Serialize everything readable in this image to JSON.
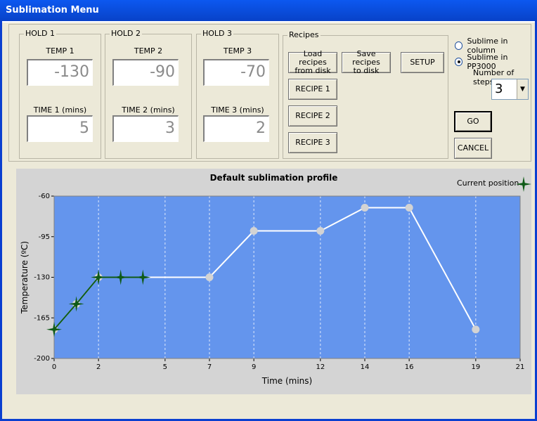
{
  "window": {
    "title": "Sublimation Menu"
  },
  "holds": [
    {
      "legend": "HOLD 1",
      "temp_label": "TEMP 1",
      "temp_value": "-130",
      "time_label": "TIME 1 (mins)",
      "time_value": "5"
    },
    {
      "legend": "HOLD 2",
      "temp_label": "TEMP 2",
      "temp_value": "-90",
      "time_label": "TIME 2 (mins)",
      "time_value": "3"
    },
    {
      "legend": "HOLD 3",
      "temp_label": "TEMP 3",
      "temp_value": "-70",
      "time_label": "TIME 3 (mins)",
      "time_value": "2"
    }
  ],
  "recipes": {
    "legend": "Recipes",
    "load_label": "Load recipes\nfrom disk",
    "save_label": "Save recipes\nto disk",
    "setup_label": "SETUP",
    "recipe1": "RECIPE 1",
    "recipe2": "RECIPE 2",
    "recipe3": "RECIPE 3"
  },
  "options": {
    "radio_column": "Sublime in column",
    "radio_pp3000": "Sublime in PP3000",
    "selected_radio": "pp3000",
    "steps_label": "Number of steps",
    "steps_value": "3",
    "go_label": "GO",
    "cancel_label": "CANCEL"
  },
  "chart_data": {
    "type": "line",
    "title": "Default sublimation profile",
    "xlabel": "Time (mins)",
    "ylabel": "Temperature (ºC)",
    "legend_current": "Current position",
    "xlim": [
      0,
      21
    ],
    "ylim": [
      -200,
      -60
    ],
    "x_ticks": [
      0,
      2,
      5,
      7,
      9,
      12,
      14,
      16,
      19,
      21
    ],
    "x_tick_labels": [
      "0",
      "2",
      "5",
      "7",
      "9",
      "12",
      "14",
      "16",
      "19",
      "21"
    ],
    "y_ticks": [
      -60,
      -95,
      -130,
      -165,
      -200
    ],
    "y_tick_labels": [
      "-60",
      "-95",
      "-130",
      "-165",
      "-200"
    ],
    "profile": [
      {
        "x": 0,
        "y": -175
      },
      {
        "x": 1.0,
        "y": -153
      },
      {
        "x": 2.0,
        "y": -130
      },
      {
        "x": 7.0,
        "y": -130
      },
      {
        "x": 9.0,
        "y": -90
      },
      {
        "x": 12.0,
        "y": -90
      },
      {
        "x": 14.0,
        "y": -70
      },
      {
        "x": 16.0,
        "y": -70
      },
      {
        "x": 19.0,
        "y": -175
      }
    ],
    "current_points": [
      {
        "x": 0,
        "y": -175
      },
      {
        "x": 1.0,
        "y": -153
      },
      {
        "x": 2.0,
        "y": -130
      },
      {
        "x": 3.0,
        "y": -130
      },
      {
        "x": 4.0,
        "y": -130
      }
    ],
    "colors": {
      "plot_bg": "#6495ed",
      "line": "#ffffff",
      "marker": "#d3d3d3",
      "current": "#0f5a17",
      "grid": "#ffffff"
    }
  }
}
